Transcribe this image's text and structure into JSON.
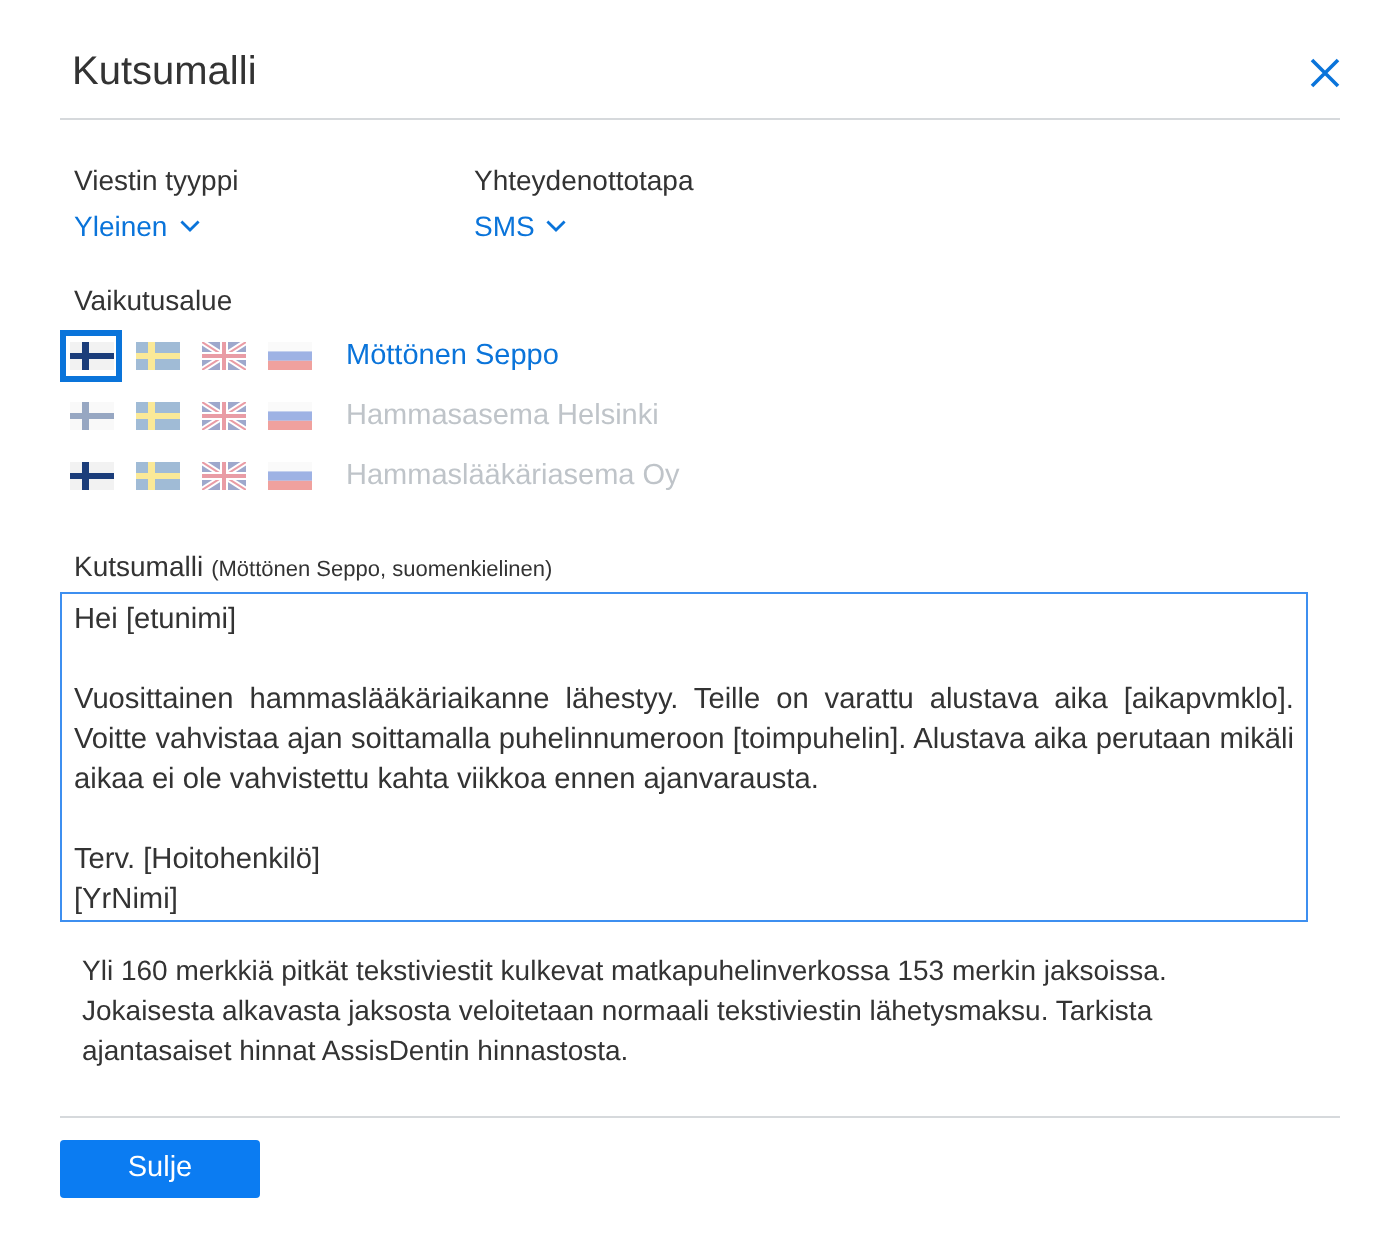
{
  "dialog": {
    "title": "Kutsumalli"
  },
  "fields": [
    {
      "label": "Viestin tyyppi",
      "value": "Yleinen"
    },
    {
      "label": "Yhteydenottotapa",
      "value": "SMS"
    }
  ],
  "scope": {
    "label": "Vaikutusalue",
    "rows": [
      {
        "name": "Möttönen Seppo",
        "selected": true,
        "flags": [
          {
            "kind": "fi",
            "available": true,
            "selected": true
          },
          {
            "kind": "se",
            "available": false,
            "selected": false
          },
          {
            "kind": "gb",
            "available": false,
            "selected": false
          },
          {
            "kind": "ru",
            "available": false,
            "selected": false
          }
        ]
      },
      {
        "name": "Hammasasema Helsinki",
        "selected": false,
        "flags": [
          {
            "kind": "fi",
            "available": false,
            "selected": false
          },
          {
            "kind": "se",
            "available": false,
            "selected": false
          },
          {
            "kind": "gb",
            "available": false,
            "selected": false
          },
          {
            "kind": "ru",
            "available": false,
            "selected": false
          }
        ]
      },
      {
        "name": "Hammaslääkäriasema Oy",
        "selected": false,
        "flags": [
          {
            "kind": "fi",
            "available": true,
            "selected": false
          },
          {
            "kind": "se",
            "available": false,
            "selected": false
          },
          {
            "kind": "gb",
            "available": false,
            "selected": false
          },
          {
            "kind": "ru",
            "available": false,
            "selected": false
          }
        ]
      }
    ]
  },
  "template": {
    "label": "Kutsumalli",
    "note": "(Möttönen Seppo, suomenkielinen)",
    "value": "Hei [etunimi]\n\nVuosittainen hammaslääkäriaikanne lähestyy. Teille on varattu alustava aika [aikapvmklo]. Voitte vahvistaa ajan soittamalla puhelinnumeroon [toimpuhelin]. Alustava aika perutaan mikäli aikaa ei ole vahvistettu kahta viikkoa ennen ajanvarausta.\n\nTerv. [Hoitohenkilö]\n[YrNimi]"
  },
  "info": "Yli 160 merkkiä pitkät tekstiviestit kulkevat matkapuhelinverkossa 153 merkin jaksoissa. Jokaisesta alkavasta jaksosta veloitetaan normaali tekstiviestin lähetysmaksu. Tarkista ajantasaiset hinnat AssisDentin hinnastosta.",
  "buttons": [
    {
      "label": "Sulje"
    }
  ]
}
